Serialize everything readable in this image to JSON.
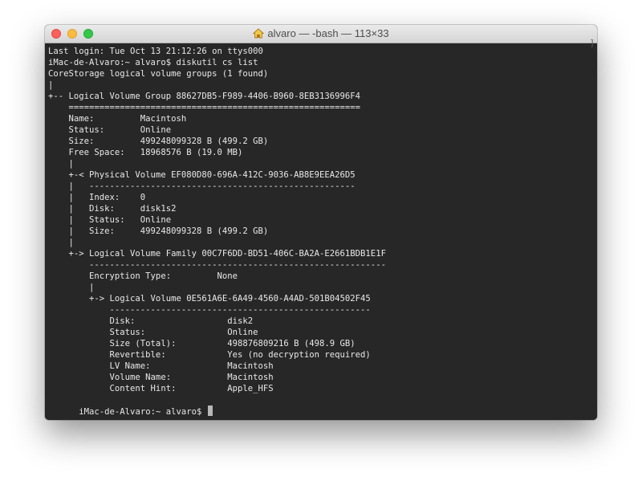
{
  "window": {
    "title": "alvaro — -bash — 113×33"
  },
  "terminal": {
    "lines": [
      "Last login: Tue Oct 13 21:12:26 on ttys000",
      "iMac-de-Alvaro:~ alvaro$ diskutil cs list",
      "CoreStorage logical volume groups (1 found)",
      "|",
      "+-- Logical Volume Group 88627DB5-F989-4406-B960-8EB3136996F4",
      "    =========================================================",
      "    Name:         Macintosh",
      "    Status:       Online",
      "    Size:         499248099328 B (499.2 GB)",
      "    Free Space:   18968576 B (19.0 MB)",
      "    |",
      "    +-< Physical Volume EF080D80-696A-412C-9036-AB8E9EEA26D5",
      "    |   ----------------------------------------------------",
      "    |   Index:    0",
      "    |   Disk:     disk1s2",
      "    |   Status:   Online",
      "    |   Size:     499248099328 B (499.2 GB)",
      "    |",
      "    +-> Logical Volume Family 00C7F6DD-BD51-406C-BA2A-E2661BDB1E1F",
      "        ----------------------------------------------------------",
      "        Encryption Type:         None",
      "        |",
      "        +-> Logical Volume 0E561A6E-6A49-4560-A4AD-501B04502F45",
      "            ---------------------------------------------------",
      "            Disk:                  disk2",
      "            Status:                Online",
      "            Size (Total):          498876809216 B (498.9 GB)",
      "            Revertible:            Yes (no decryption required)",
      "            LV Name:               Macintosh",
      "            Volume Name:           Macintosh",
      "            Content Hint:          Apple_HFS"
    ],
    "prompt": "iMac-de-Alvaro:~ alvaro$ "
  },
  "colors": {
    "terminal_background": "#272727",
    "terminal_text": "#e8e8e8",
    "close_button": "#fc605c",
    "minimize_button": "#fdbc40",
    "zoom_button": "#34c84a"
  },
  "icons": {
    "title_icon": "home-icon",
    "buttons": [
      "close-icon",
      "minimize-icon",
      "zoom-icon"
    ]
  }
}
